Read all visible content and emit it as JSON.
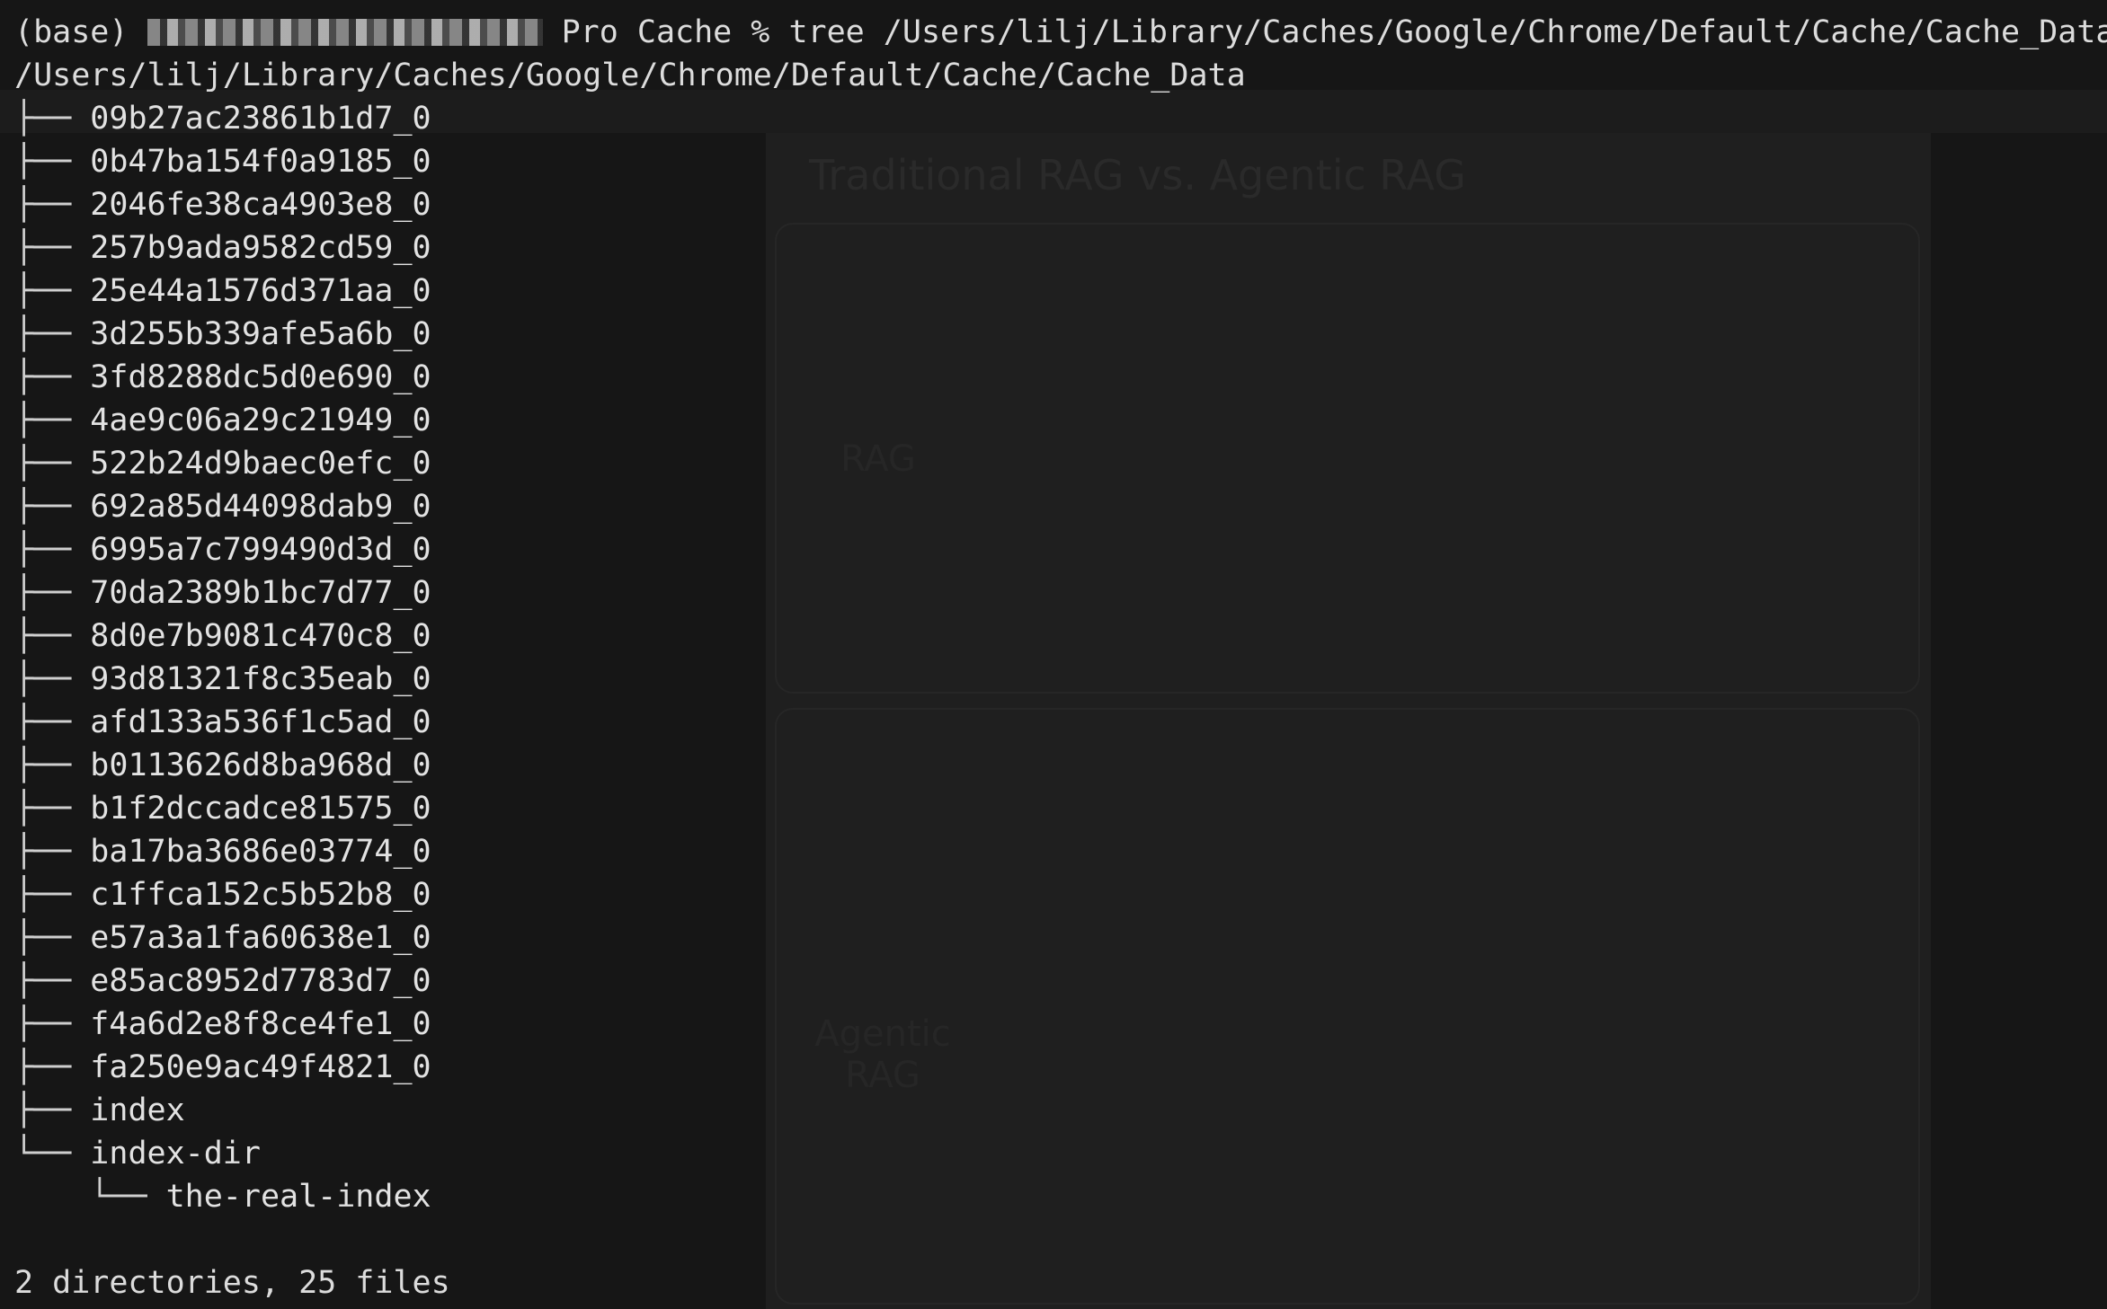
{
  "terminal": {
    "prompt_prefix": "(base) ",
    "prompt_suffix": " Pro Cache % tree /Users/lilj/Library/Caches/Google/Chrome/Default/Cache/Cache_Data",
    "root_path": "/Users/lilj/Library/Caches/Google/Chrome/Default/Cache/Cache_Data",
    "entries": [
      "09b27ac23861b1d7_0",
      "0b47ba154f0a9185_0",
      "2046fe38ca4903e8_0",
      "257b9ada9582cd59_0",
      "25e44a1576d371aa_0",
      "3d255b339afe5a6b_0",
      "3fd8288dc5d0e690_0",
      "4ae9c06a29c21949_0",
      "522b24d9baec0efc_0",
      "692a85d44098dab9_0",
      "6995a7c799490d3d_0",
      "70da2389b1bc7d77_0",
      "8d0e7b9081c470c8_0",
      "93d81321f8c35eab_0",
      "afd133a536f1c5ad_0",
      "b0113626d8ba968d_0",
      "b1f2dccadce81575_0",
      "ba17ba3686e03774_0",
      "c1ffca152c5b52b8_0",
      "e57a3a1fa60638e1_0",
      "e85ac8952d7783d7_0",
      "f4a6d2e8f8ce4fe1_0",
      "fa250e9ac49f4821_0",
      "index"
    ],
    "last_entry": "index-dir",
    "nested_entry": "the-real-index",
    "branch_mid": "├── ",
    "branch_last": "└── ",
    "nested_indent": "    ",
    "summary": "2 directories, 25 files"
  },
  "background": {
    "title": "Traditional RAG vs. Agentic RAG",
    "rag_label": "RAG",
    "agentic_label": "Agentic RAG"
  }
}
